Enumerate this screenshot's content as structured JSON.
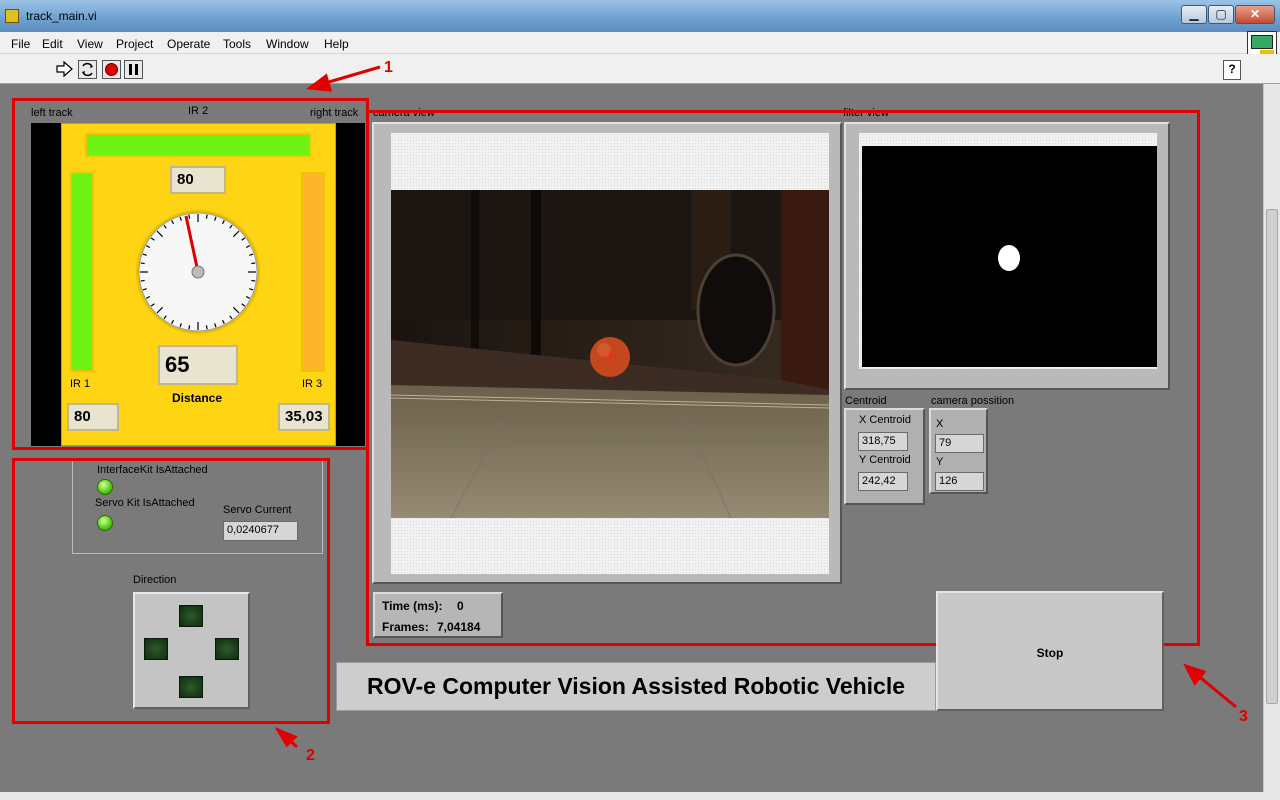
{
  "window": {
    "title": "track_main.vi",
    "minimize": "▁",
    "maximize": "▢",
    "close": "✕"
  },
  "menu": [
    "File",
    "Edit",
    "View",
    "Project",
    "Operate",
    "Tools",
    "Window",
    "Help"
  ],
  "toolbar": {
    "run_icon": "run-arrow-icon",
    "run_continuous_icon": "run-continuously-icon",
    "abort_icon": "abort-icon",
    "pause_icon": "pause-icon",
    "help_label": "?"
  },
  "annotations": [
    "1",
    "2",
    "3"
  ],
  "panel1": {
    "left_track": "left track",
    "ir2": "IR 2",
    "right_track": "right track",
    "ir2_value": "80",
    "distance_value": "65",
    "distance_label": "Distance",
    "ir1": "IR 1",
    "ir3": "IR 3",
    "ir1_value": "80",
    "ir3_value": "35,03"
  },
  "panel2": {
    "interfacekit_label": "InterfaceKit IsAttached",
    "servokit_label": "Servo Kit IsAttached",
    "servo_current_label": "Servo Current",
    "servo_current_value": "0,0240677",
    "direction_label": "Direction"
  },
  "panel3": {
    "camera_view_label": "camera view",
    "filter_view_label": "filter view",
    "centroid_label": "Centroid",
    "x_centroid_label": "X Centroid",
    "x_centroid_value": "318,75",
    "y_centroid_label": "Y Centroid",
    "y_centroid_value": "242,42",
    "camera_position_label": "camera possition",
    "x_label": "X",
    "x_value": "79",
    "y_label": "Y",
    "y_value": "126",
    "time_label": "Time (ms):",
    "time_value": "0",
    "frames_label": "Frames:",
    "frames_value": "7,04184"
  },
  "stop_label": "Stop",
  "banner": "ROV-e Computer Vision Assisted Robotic Vehicle",
  "colors": {
    "panel_bg": "#7a7a7a",
    "yellow": "#ffd414",
    "meter_green": "#6ef216",
    "meter_orange": "#ffb52a",
    "annotation_red": "#e00000"
  }
}
